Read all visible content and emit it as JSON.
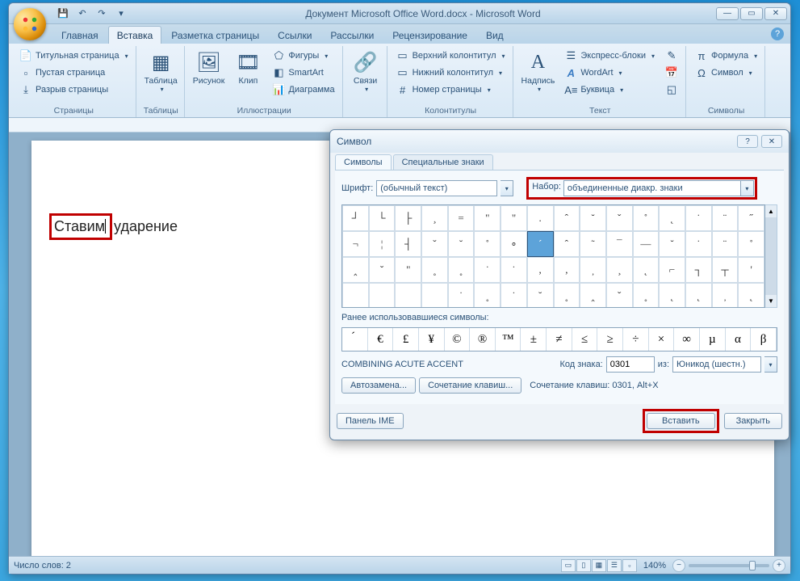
{
  "window": {
    "title": "Документ Microsoft Office Word.docx - Microsoft Word"
  },
  "tabs": {
    "home": "Главная",
    "insert": "Вставка",
    "page_layout": "Разметка страницы",
    "references": "Ссылки",
    "mailings": "Рассылки",
    "review": "Рецензирование",
    "view": "Вид"
  },
  "ribbon": {
    "pages": {
      "title_page": "Титульная страница",
      "blank_page": "Пустая страница",
      "page_break": "Разрыв страницы",
      "group": "Страницы"
    },
    "tables": {
      "table": "Таблица",
      "group": "Таблицы"
    },
    "illustrations": {
      "picture": "Рисунок",
      "clip": "Клип",
      "shapes": "Фигуры",
      "smartart": "SmartArt",
      "chart": "Диаграмма",
      "group": "Иллюстрации"
    },
    "links": {
      "links": "Связи",
      "group": ""
    },
    "header_footer": {
      "header": "Верхний колонтитул",
      "footer": "Нижний колонтитул",
      "page_number": "Номер страницы",
      "group": "Колонтитулы"
    },
    "text": {
      "text_box": "Надпись",
      "quick_parts": "Экспресс-блоки",
      "wordart": "WordArt",
      "drop_cap": "Буквица",
      "group": "Текст"
    },
    "symbols": {
      "equation": "Формула",
      "symbol": "Символ",
      "group": "Символы"
    }
  },
  "document": {
    "text_boxed": "Ставим",
    "text_rest": " ударение"
  },
  "dialog": {
    "title": "Символ",
    "tab_symbols": "Символы",
    "tab_special": "Специальные знаки",
    "font_label": "Шрифт:",
    "font_value": "(обычный текст)",
    "set_label": "Набор:",
    "set_value": "объединенные диакр. знаки",
    "grid": [
      "┘",
      "└",
      "├",
      "¸",
      "=",
      "\"",
      "\"",
      ".",
      "ˆ",
      "˘",
      "ˇ",
      "˚",
      "˛",
      "˙",
      "¨",
      "˝",
      "¬",
      "¦",
      "┤",
      "ˇ",
      "˘",
      "˚",
      "∘",
      "´",
      "ˆ",
      "˜",
      "¯",
      "—",
      "˘",
      "˙",
      "¨",
      "˚",
      "‸",
      "ˇ",
      "\"",
      "˳",
      "˳",
      "˙",
      "˙",
      ",",
      ",",
      "̦",
      "̧",
      "̨",
      "⌐",
      "┐",
      "┬",
      "'",
      "",
      "",
      "",
      "",
      "˙",
      "˳",
      "˙",
      "˘",
      "˳",
      "‸",
      "ˇ",
      "˳",
      "˛",
      "̨",
      "̦",
      "˛"
    ],
    "selected_index": 23,
    "recent_label": "Ранее использовавшиеся символы:",
    "recent": [
      "́",
      "€",
      "£",
      "¥",
      "©",
      "®",
      "™",
      "±",
      "≠",
      "≤",
      "≥",
      "÷",
      "×",
      "∞",
      "µ",
      "α",
      "β"
    ],
    "char_name": "COMBINING ACUTE ACCENT",
    "code_label": "Код знака:",
    "code_value": "0301",
    "from_label": "из:",
    "from_value": "Юникод (шестн.)",
    "autocorrect": "Автозамена...",
    "shortcut_btn": "Сочетание клавиш...",
    "shortcut_label": "Сочетание клавиш: 0301, Alt+X",
    "ime_panel": "Панель IME",
    "insert": "Вставить",
    "close": "Закрыть"
  },
  "status": {
    "word_count": "Число слов: 2",
    "zoom": "140%"
  }
}
